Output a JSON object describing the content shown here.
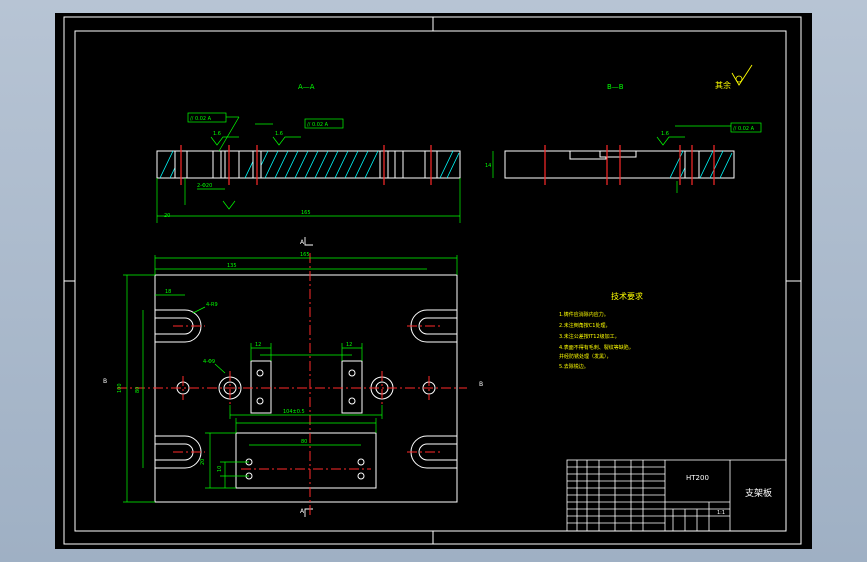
{
  "colors": {
    "background": "#000000",
    "outline": "#ffffff",
    "dimension": "#00ff00",
    "centerline": "#ff2a2a",
    "hatch": "#00ffff",
    "text": "#ffff00",
    "viewport": "#a7b6c9"
  },
  "drawing": {
    "section_a_label": "A—A",
    "section_b_label": "B—B",
    "roughness_other": "其余",
    "section_a_cut_top": "A",
    "section_a_cut_bottom": "A",
    "section_b_cut_left": "B",
    "section_b_cut_right": "B",
    "dims": {
      "top_overall": "165",
      "top_inner": "135",
      "left_height": "100",
      "left_inner": "80",
      "section_length": "165",
      "section_left": "20",
      "center_dist": "104±0.5",
      "slot_width": "18",
      "slot_width_2": "12",
      "hole_label": "4-Φ9",
      "hole_label_2": "2-Φ20",
      "groove_label": "4-R9",
      "bottom_width": "80",
      "bottom_height": "20",
      "bottom_left": "10",
      "side_height": "14",
      "tol_a": "// 0.02 A",
      "tol_b": "// 0.02 A",
      "tol_c": "// 0.02 A",
      "rough_1": "1.6",
      "rough_2": "1.6",
      "rough_3": "1.6"
    }
  },
  "tech_requirements": {
    "title": "技术要求",
    "items": [
      "1.铸件应消除内应力。",
      "2.未注倒角按C1处理，",
      "3.未注公差按IT12级加工，",
      "4.表面不得有毛刺、裂纹等缺陷，",
      "  并经防锈处理（发黑），",
      "5.去除锐边。"
    ]
  },
  "title_block": {
    "material": "HT200",
    "part_name": "支架板",
    "scale": "1:1"
  }
}
